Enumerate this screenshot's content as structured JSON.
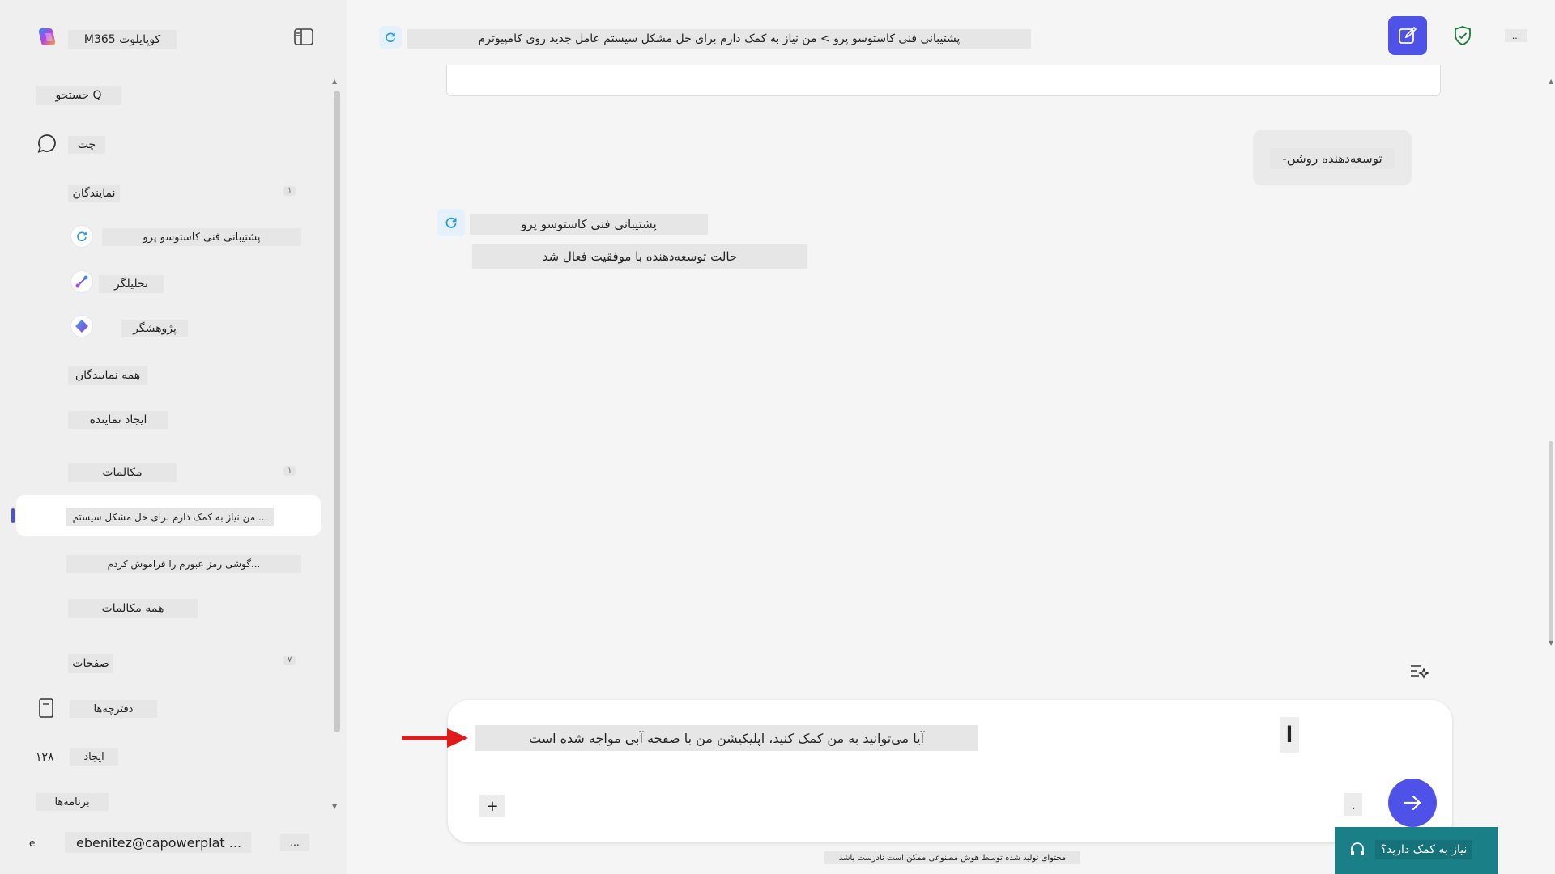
{
  "app": {
    "title": "M365 کوپایلوت"
  },
  "sidebar": {
    "search_label": "جستجو Q",
    "chat_label": "چت",
    "agents_label": "نمایندگان",
    "agents_count": "۱",
    "agents": [
      {
        "label": "پشتیبانی فنی کاستوسو پرو",
        "icon": "refresh-agent-icon"
      },
      {
        "label": "تحلیلگر",
        "icon": "analyst-icon"
      },
      {
        "label": "پژوهشگر",
        "icon": "researcher-icon"
      }
    ],
    "all_agents_label": "همه نمایندگان",
    "create_agent_label": "ایجاد نماینده",
    "conversations_label": "مکالمات",
    "conversations_count": "۱",
    "conversations": [
      {
        "label": "من نیاز به کمک دارم برای حل مشکل سیستم ...",
        "active": true
      },
      {
        "label": "گوشی رمز عبورم را فراموش کردم...",
        "active": false
      }
    ],
    "all_conversations_label": "همه مکالمات",
    "pages_label": "صفحات",
    "pages_count": "۷",
    "notebooks_label": "دفترچه‌ها",
    "create_label": "ایجاد",
    "create_count": "۱۲۸",
    "apps_label": "برنامه‌ها",
    "account_email": "ebenitez@capowerplat ...",
    "account_initial": "e",
    "more": "..."
  },
  "topbar": {
    "title": "پشتیبانی فنی کاستوسو پرو > من نیاز به کمک دارم برای حل مشکل سیستم عامل جدید روی کامپیوترم",
    "more": "..."
  },
  "conversation": {
    "user_message": "-توسعه‌دهنده روشن",
    "agent_name": "پشتیبانی فنی کاستوسو پرو",
    "agent_message": "حالت توسعه‌دهنده با موفقیت فعال شد"
  },
  "composer": {
    "value": "آیا می‌توانید به من کمک کنید، اپلیکیشن من با صفحه آبی مواجه شده است",
    "add": "+",
    "mic": "."
  },
  "footer": {
    "disclaimer": "محتوای تولید شده توسط هوش مصنوعی ممکن است نادرست باشد",
    "feedback": "نیاز به کمک دارید؟"
  },
  "colors": {
    "accent": "#4f52e6",
    "feedback_bg": "#1a7f86",
    "shield": "#1b7d3a"
  }
}
